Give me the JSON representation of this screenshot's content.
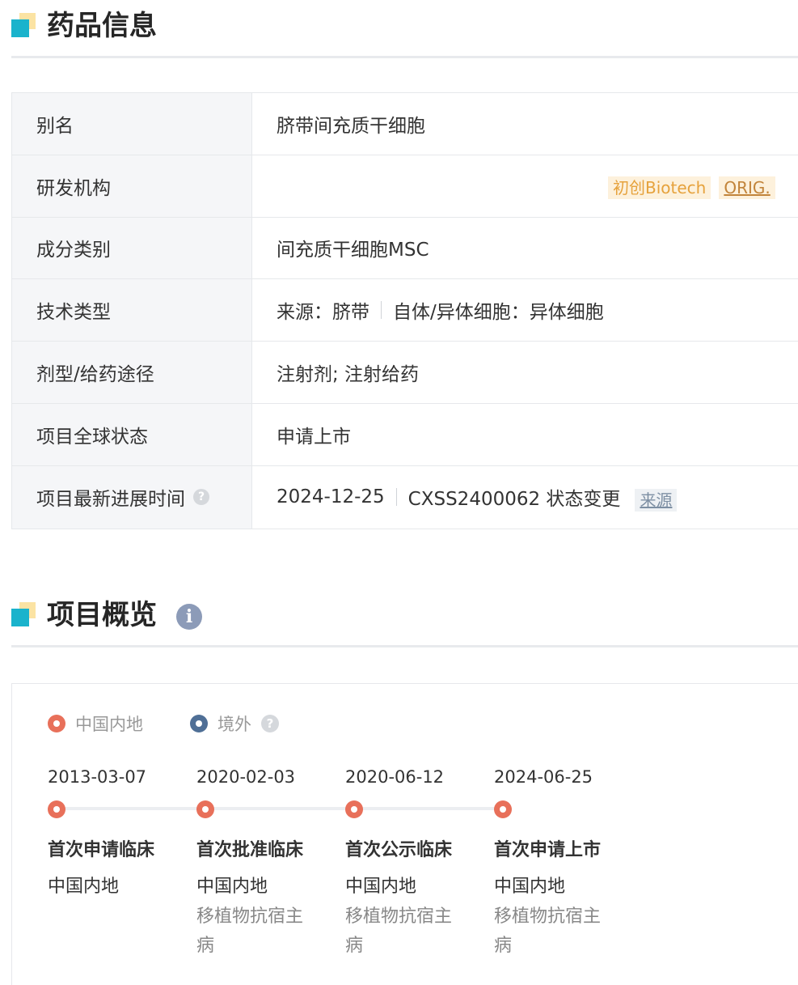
{
  "drug_info": {
    "title": "药品信息",
    "rows": [
      {
        "label": "别名",
        "value": "脐带间充质干细胞"
      },
      {
        "label": "研发机构",
        "company_badge": "初创Biotech",
        "orig_badge": "ORIG."
      },
      {
        "label": "成分类别",
        "value": "间充质干细胞MSC"
      },
      {
        "label": "技术类型",
        "value_a": "来源：脐带",
        "value_b": "自体/异体细胞：异体细胞"
      },
      {
        "label": "剂型/给药途径",
        "value": "注射剂; 注射给药"
      },
      {
        "label": "项目全球状态",
        "value": "申请上市"
      },
      {
        "label": "项目最新进展时间",
        "date": "2024-12-25",
        "event": "CXSS2400062 状态变更",
        "source": "来源"
      }
    ]
  },
  "overview": {
    "title": "项目概览",
    "legend": [
      {
        "label": "中国内地",
        "color": "#e8705a"
      },
      {
        "label": "境外",
        "color": "#4f6f96"
      }
    ],
    "milestones": [
      {
        "date": "2013-03-07",
        "event": "首次申请临床",
        "region": "中国内地",
        "indication": ""
      },
      {
        "date": "2020-02-03",
        "event": "首次批准临床",
        "region": "中国内地",
        "indication": "移植物抗宿主病"
      },
      {
        "date": "2020-06-12",
        "event": "首次公示临床",
        "region": "中国内地",
        "indication": "移植物抗宿主病"
      },
      {
        "date": "2024-06-25",
        "event": "首次申请上市",
        "region": "中国内地",
        "indication": "移植物抗宿主病"
      }
    ]
  }
}
